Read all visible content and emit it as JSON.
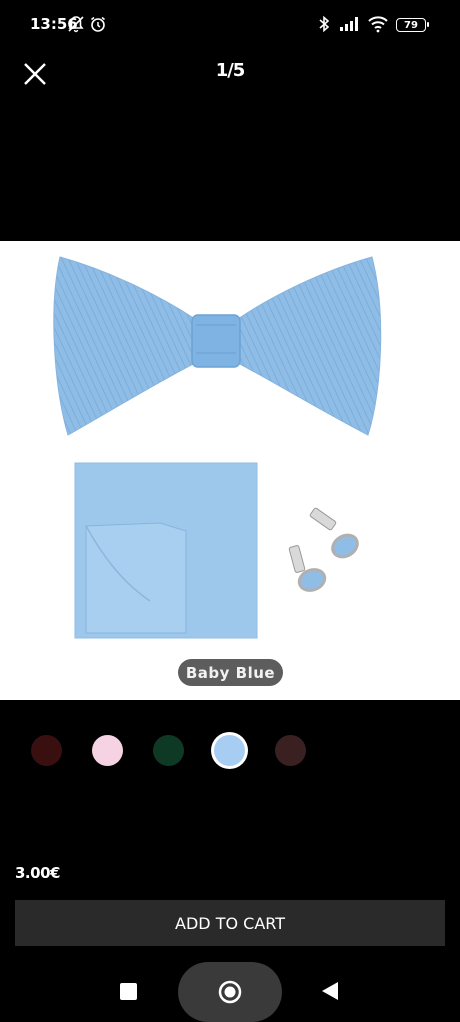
{
  "status": {
    "time": "13:56",
    "battery": "79",
    "icons": [
      "bell-off-icon",
      "alarm-icon",
      "bluetooth-icon",
      "signal-icon",
      "wifi-icon",
      "battery-icon"
    ]
  },
  "viewer": {
    "counter": "1/5",
    "close_icon": "close-icon"
  },
  "product": {
    "image_label": "Baby Blue",
    "price": "3.00€",
    "add_to_cart": "ADD TO CART",
    "swatches": [
      {
        "color": "#3a0f0f"
      },
      {
        "color": "#f6d3e3"
      },
      {
        "color": "#0e3a25"
      },
      {
        "color": "#a8cdf2",
        "selected": true
      },
      {
        "color": "#3a2020"
      }
    ]
  },
  "navbar": {
    "icons": [
      "recent-apps-icon",
      "home-icon",
      "back-icon"
    ]
  }
}
